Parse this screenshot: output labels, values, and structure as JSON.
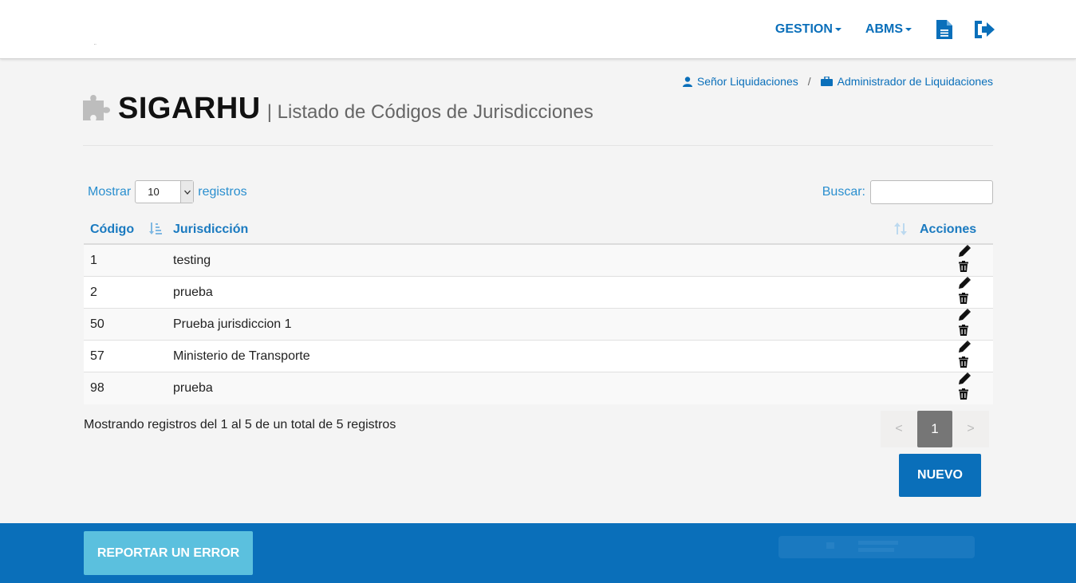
{
  "nav": {
    "gestion_label": "GESTION",
    "abms_label": "ABMS"
  },
  "breadcrumb": {
    "user_label": "Señor Liquidaciones",
    "separator": "/",
    "role_label": "Administrador de Liquidaciones"
  },
  "header": {
    "title": "SIGARHU",
    "subtitle": "| Listado de Códigos de Jurisdicciones"
  },
  "table_controls": {
    "show_label": "Mostrar",
    "length_value": "10",
    "records_label": "registros",
    "search_label": "Buscar:",
    "search_value": ""
  },
  "table": {
    "columns": [
      "Código",
      "Jurisdicción",
      "Acciones"
    ],
    "rows": [
      {
        "codigo": "1",
        "jurisdiccion": "testing"
      },
      {
        "codigo": "2",
        "jurisdiccion": "prueba"
      },
      {
        "codigo": "50",
        "jurisdiccion": "Prueba jurisdiccion 1"
      },
      {
        "codigo": "57",
        "jurisdiccion": "Ministerio de Transporte"
      },
      {
        "codigo": "98",
        "jurisdiccion": "prueba"
      }
    ]
  },
  "table_info": "Mostrando registros del 1 al 5 de un total de 5 registros",
  "pagination": {
    "prev": "<",
    "current": "1",
    "next": ">"
  },
  "buttons": {
    "nuevo": "NUEVO",
    "reportar": "REPORTAR UN ERROR"
  },
  "icons": {
    "document": "document-icon",
    "logout": "logout-icon",
    "user": "user-icon",
    "briefcase": "briefcase-icon",
    "puzzle": "puzzle-icon",
    "edit": "pencil-icon",
    "delete": "trash-icon"
  },
  "colors": {
    "primary": "#0a6fba",
    "link": "#2a8fcf",
    "report_button": "#5bc0de",
    "page_active": "#767676"
  }
}
